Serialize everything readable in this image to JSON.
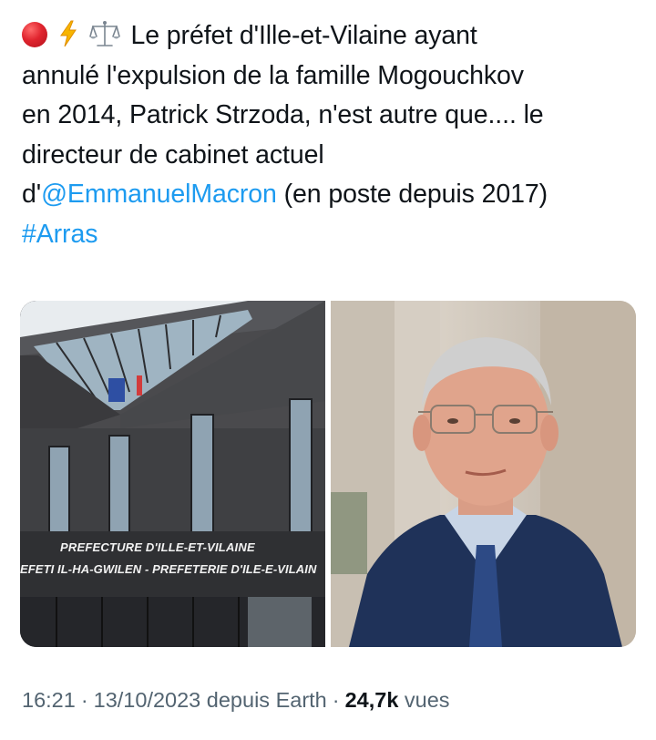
{
  "tweet": {
    "emojis": [
      "red-circle",
      "high-voltage",
      "balance-scale"
    ],
    "lines": [
      "Le préfet d'Ille-et-Vilaine ayant",
      "annulé l'expulsion de la famille Mogouchkov",
      "en 2014, Patrick Strzoda, n'est autre que.... le",
      "directeur de cabinet actuel"
    ],
    "line5_prefix": "d'",
    "mention": "@EmmanuelMacron",
    "line5_suffix": " (en poste depuis 2017)",
    "hashtag": "#Arras"
  },
  "media": {
    "left_image": {
      "sign_line_1": "PREFECTURE D'ILLE-ET-VILAINE",
      "sign_line_2": "EFETI IL-HA-GWILEN  -  PREFETERIE D'ILE-E-VILAIN"
    },
    "right_image": {}
  },
  "meta": {
    "time": "16:21",
    "date": "13/10/2023",
    "source": "depuis Earth",
    "views_count": "24,7k",
    "views_label": "vues"
  },
  "colors": {
    "text": "#0f1419",
    "link": "#1d9bf0",
    "meta": "#536471"
  }
}
